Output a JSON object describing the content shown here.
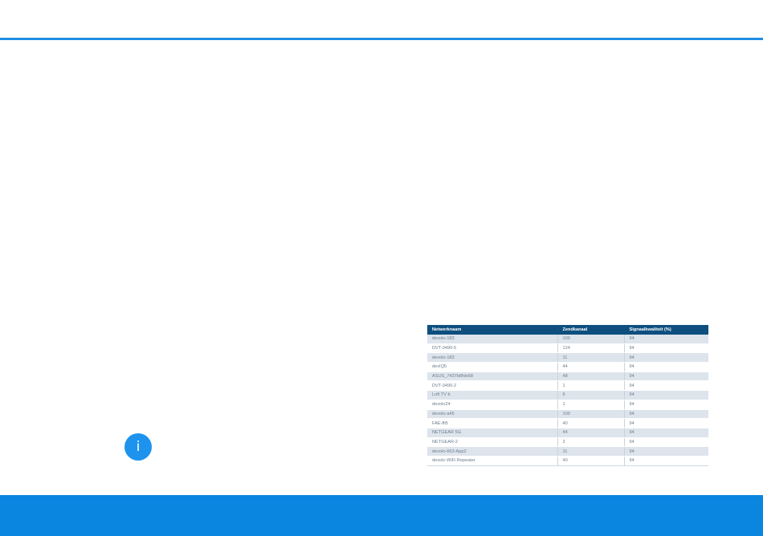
{
  "colors": {
    "accent_rule": "#1f8fe3",
    "footer_band": "#0a85e0",
    "info_badge": "#1d93ee",
    "table_header": "#0e4f7f",
    "row_shaded": "#dde4ec"
  },
  "info_badge": {
    "icon": "info-icon",
    "glyph": "i"
  },
  "table": {
    "headers": [
      "Netwerknaam",
      "Zendkanaal",
      "Signaalkwaliteit (%)"
    ],
    "rows": [
      [
        "devolo-183",
        "100",
        "94"
      ],
      [
        "DVT-3490-5",
        "124",
        "94"
      ],
      [
        "devolo-183",
        "11",
        "94"
      ],
      [
        "devIQ5",
        "44",
        "94"
      ],
      [
        "ASUS_7437b8fde68",
        "48",
        "94"
      ],
      [
        "DVT-3490-2",
        "1",
        "94"
      ],
      [
        "Loft TV b",
        "6",
        "94"
      ],
      [
        "devolo24",
        "1",
        "94"
      ],
      [
        "devolo-a45",
        "100",
        "94"
      ],
      [
        "FAE-ffi5",
        "40",
        "94"
      ],
      [
        "NETGEAR 5G",
        "44",
        "94"
      ],
      [
        "NETGEAR-2",
        "2",
        "94"
      ],
      [
        "devolo-663-App2",
        "11",
        "94"
      ],
      [
        "devolo WiFi Repeater",
        "40",
        "94"
      ]
    ]
  }
}
